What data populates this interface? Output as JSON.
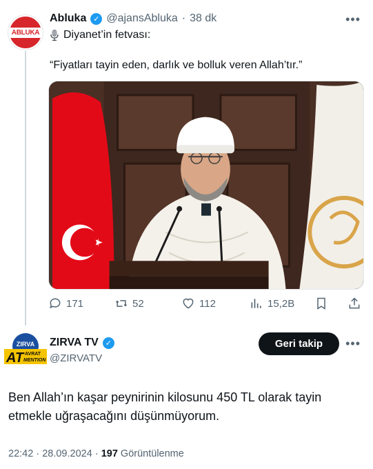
{
  "quoted_tweet": {
    "author_name": "Abluka",
    "avatar_text": "ABLUKA",
    "handle": "@ajansAbluka",
    "separator": "·",
    "time": "38 dk",
    "subtitle": "Diyanet’in fetvası:",
    "quote": "“Fiyatları tayin eden, darlık ve bolluk veren Allah’tır.”",
    "more_label": "•••",
    "actions": {
      "replies": "171",
      "retweets": "52",
      "likes": "112",
      "views": "15,2B"
    }
  },
  "main_tweet": {
    "author_name": "ZIRVA TV",
    "handle": "@ZIRVATV",
    "avatar_top_text": "ZIRVA",
    "avatar_left_text": "AT",
    "avatar_right_top": "AVRAT",
    "avatar_right_bottom": "MENTION",
    "follow_label": "Geri takip",
    "more_label": "•••",
    "text": "Ben Allah’ın kaşar peynirinin kilosunu 450 TL olarak tayin etmekle uğraşacağını düşünmüyorum.",
    "time": "22:42",
    "date": "28.09.2024",
    "separator": "·",
    "views_count": "197",
    "views_label": "Görüntülenme"
  },
  "colors": {
    "accent": "#1d9bf0",
    "text": "#0f1419",
    "muted": "#536471",
    "flag_red": "#e30a17",
    "brand_red": "#d7262b"
  }
}
